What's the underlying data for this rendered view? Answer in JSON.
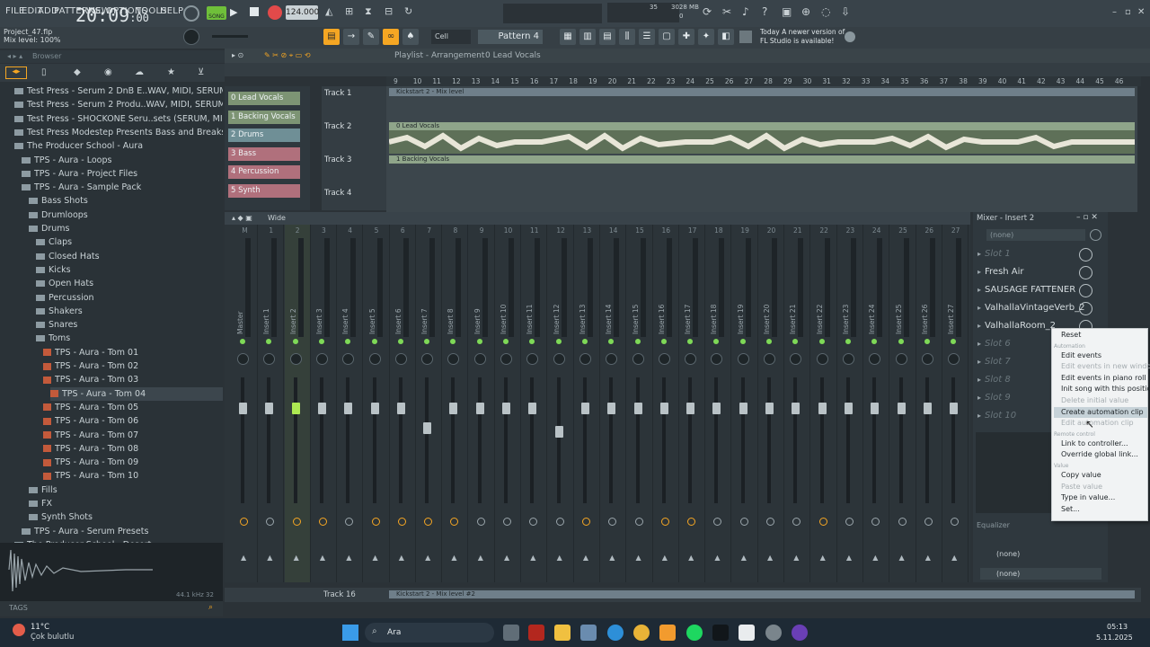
{
  "menu": {
    "items": [
      "FILE",
      "EDIT",
      "ADD",
      "PATTERNS",
      "VIEW",
      "OPTIONS",
      "TOOLS",
      "HELP"
    ]
  },
  "transport": {
    "mode": "SONG",
    "tempo": "124.000",
    "time": "20:09",
    "time_sub": ":00",
    "cpu_label": "35",
    "ram": "3028 MB",
    "ram_sub": "0"
  },
  "project": {
    "name": "Project_47.flp",
    "hint": "Mix level: 100%"
  },
  "toolbar": {
    "snap": "Cell",
    "pattern": "Pattern 4",
    "news_line1": "Today    A newer version of",
    "news_line2": "FL Studio is available!"
  },
  "browser": {
    "title": "Browser",
    "items": [
      {
        "label": "Test Press - Serum 2 DnB E..WAV, MIDI, SERUM 2) (2025)",
        "indent": 2,
        "type": "folder"
      },
      {
        "label": "Test Press - Serum 2 Produ..WAV, MIDI, SERUM 2) (2025)",
        "indent": 2,
        "type": "folder"
      },
      {
        "label": "Test Press - SHOCKONE Seru..sets (SERUM, MIDI) (2025)",
        "indent": 2,
        "type": "folder"
      },
      {
        "label": "Test Press Modestep Presents Bass and Breaks Vol 1",
        "indent": 2,
        "type": "folder"
      },
      {
        "label": "The Producer School - Aura",
        "indent": 2,
        "type": "folder"
      },
      {
        "label": "TPS - Aura - Loops",
        "indent": 3,
        "type": "folder"
      },
      {
        "label": "TPS - Aura - Project Files",
        "indent": 3,
        "type": "folder"
      },
      {
        "label": "TPS - Aura - Sample Pack",
        "indent": 3,
        "type": "folder"
      },
      {
        "label": "Bass Shots",
        "indent": 4,
        "type": "folder"
      },
      {
        "label": "Drumloops",
        "indent": 4,
        "type": "folder"
      },
      {
        "label": "Drums",
        "indent": 4,
        "type": "folder"
      },
      {
        "label": "Claps",
        "indent": 5,
        "type": "folder"
      },
      {
        "label": "Closed Hats",
        "indent": 5,
        "type": "folder"
      },
      {
        "label": "Kicks",
        "indent": 5,
        "type": "folder"
      },
      {
        "label": "Open Hats",
        "indent": 5,
        "type": "folder"
      },
      {
        "label": "Percussion",
        "indent": 5,
        "type": "folder"
      },
      {
        "label": "Shakers",
        "indent": 5,
        "type": "folder"
      },
      {
        "label": "Snares",
        "indent": 5,
        "type": "folder"
      },
      {
        "label": "Toms",
        "indent": 5,
        "type": "folder"
      },
      {
        "label": "TPS - Aura - Tom 01",
        "indent": 6,
        "type": "wav"
      },
      {
        "label": "TPS - Aura - Tom 02",
        "indent": 6,
        "type": "wav"
      },
      {
        "label": "TPS - Aura - Tom 03",
        "indent": 6,
        "type": "wav"
      },
      {
        "label": "TPS - Aura - Tom 04",
        "indent": 7,
        "type": "wav"
      },
      {
        "label": "TPS - Aura - Tom 05",
        "indent": 6,
        "type": "wav"
      },
      {
        "label": "TPS - Aura - Tom 06",
        "indent": 6,
        "type": "wav"
      },
      {
        "label": "TPS - Aura - Tom 07",
        "indent": 6,
        "type": "wav"
      },
      {
        "label": "TPS - Aura - Tom 08",
        "indent": 6,
        "type": "wav"
      },
      {
        "label": "TPS - Aura - Tom 09",
        "indent": 6,
        "type": "wav"
      },
      {
        "label": "TPS - Aura - Tom 10",
        "indent": 6,
        "type": "wav"
      },
      {
        "label": "Fills",
        "indent": 4,
        "type": "folder"
      },
      {
        "label": "FX",
        "indent": 4,
        "type": "folder"
      },
      {
        "label": "Synth Shots",
        "indent": 4,
        "type": "folder"
      },
      {
        "label": "TPS - Aura - Serum Presets",
        "indent": 3,
        "type": "folder"
      },
      {
        "label": "The Producer School - Desert",
        "indent": 2,
        "type": "folder"
      }
    ],
    "sample_info": "44.1 kHz 32",
    "tags_label": "TAGS"
  },
  "playlist": {
    "title": "Playlist - Arrangement",
    "pattern": "0 Lead Vocals",
    "channels": [
      {
        "label": "0 Lead Vocals",
        "color": "#7d9474"
      },
      {
        "label": "1 Backing Vocals",
        "color": "#7d9474"
      },
      {
        "label": "2 Drums",
        "color": "#6f8f96"
      },
      {
        "label": "3 Bass",
        "color": "#b0707c"
      },
      {
        "label": "4 Percussion",
        "color": "#b0707c"
      },
      {
        "label": "5 Synth",
        "color": "#b0707c"
      }
    ],
    "tracks": [
      "Track 1",
      "Track 2",
      "Track 3",
      "Track 4"
    ],
    "bottom_track": "Track 16",
    "bottom_clip": "Kickstart 2 - Mix level #2",
    "clips": [
      "Kickstart 2 - Mix level",
      "0 Lead Vocals",
      "1 Backing Vocals"
    ],
    "ruler": [
      "9",
      "10",
      "11",
      "12",
      "13",
      "14",
      "15",
      "16",
      "17",
      "18",
      "19",
      "20",
      "21",
      "22",
      "23",
      "24",
      "25",
      "26",
      "27",
      "28",
      "29",
      "30",
      "31",
      "32",
      "33",
      "34",
      "35",
      "36",
      "37",
      "38",
      "39",
      "40",
      "41",
      "42",
      "43",
      "44",
      "45",
      "46"
    ]
  },
  "mixer": {
    "title": "Mixer - Insert 2",
    "view": "Wide",
    "strips": [
      "Master",
      "Insert 1",
      "Insert 2",
      "Insert 3",
      "Insert 4",
      "Insert 5",
      "Insert 6",
      "Insert 7",
      "Insert 8",
      "Insert 9",
      "Insert 10",
      "Insert 11",
      "Insert 12",
      "Insert 13",
      "Insert 14",
      "Insert 15",
      "Insert 16",
      "Insert 17",
      "Insert 18",
      "Insert 19",
      "Insert 20",
      "Insert 21",
      "Insert 22",
      "Insert 23",
      "Insert 24",
      "Insert 25",
      "Insert 26",
      "Insert 27"
    ],
    "strip_nums": [
      "M",
      "1",
      "2",
      "3",
      "4",
      "5",
      "6",
      "7",
      "8",
      "9",
      "10",
      "11",
      "12",
      "13",
      "14",
      "15",
      "16",
      "17",
      "18",
      "19",
      "20",
      "21",
      "22",
      "23",
      "24",
      "25",
      "26",
      "27"
    ],
    "input": "(none)",
    "slots": [
      "Slot 1",
      "Fresh Air",
      "SAUSAGE FATTENER",
      "ValhallaVintageVerb_2",
      "ValhallaRoom_2",
      "Slot 6",
      "Slot 7",
      "Slot 8",
      "Slot 9",
      "Slot 10"
    ],
    "eq_label": "Equalizer",
    "output1": "(none)",
    "output2": "(none)"
  },
  "context_menu": {
    "items": [
      {
        "label": "Reset",
        "disabled": false
      },
      {
        "label": "Automation",
        "section": true
      },
      {
        "label": "Edit events",
        "disabled": false
      },
      {
        "label": "Edit events in new window",
        "disabled": true
      },
      {
        "label": "Edit events in piano roll",
        "disabled": false
      },
      {
        "label": "Init song with this position",
        "disabled": false
      },
      {
        "label": "Delete initial value",
        "disabled": true
      },
      {
        "label": "Create automation clip",
        "disabled": false,
        "highlight": true
      },
      {
        "label": "Edit automation clip",
        "disabled": true
      },
      {
        "label": "Remote control",
        "section": true
      },
      {
        "label": "Link to controller...",
        "disabled": false
      },
      {
        "label": "Override global link...",
        "disabled": false
      },
      {
        "label": "Value",
        "section": true
      },
      {
        "label": "Copy value",
        "disabled": false
      },
      {
        "label": "Paste value",
        "disabled": true
      },
      {
        "label": "Type in value...",
        "disabled": false
      },
      {
        "label": "Set...",
        "disabled": false
      }
    ]
  },
  "taskbar": {
    "temp": "11°C",
    "weather": "Çok bulutlu",
    "search": "Ara",
    "time": "05:13",
    "date": "5.11.2025"
  },
  "colors": {
    "accent": "#f5a623",
    "active_green": "#aeea52",
    "led": "#7ed957"
  }
}
